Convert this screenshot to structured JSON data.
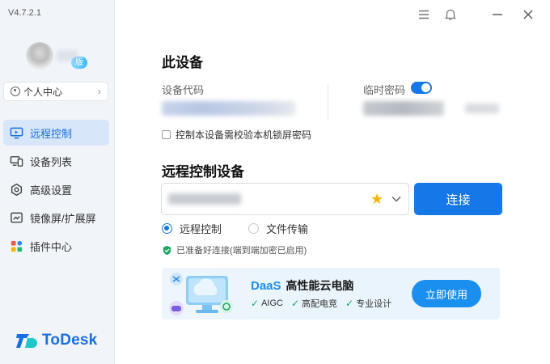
{
  "app": {
    "version": "V4.7.2.1",
    "brand": "ToDesk",
    "accent": "#1677e8"
  },
  "profile": {
    "badge": "版",
    "center_label": "个人中心"
  },
  "nav": {
    "items": [
      {
        "label": "远程控制",
        "icon": "remote-control-icon",
        "active": true
      },
      {
        "label": "设备列表",
        "icon": "device-list-icon",
        "active": false
      },
      {
        "label": "高级设置",
        "icon": "settings-icon",
        "active": false
      },
      {
        "label": "镜像屏/扩展屏",
        "icon": "mirror-screen-icon",
        "active": false
      },
      {
        "label": "插件中心",
        "icon": "plugin-icon",
        "active": false
      }
    ]
  },
  "titlebar": {
    "icons": [
      "menu-icon",
      "bell-icon",
      "minimize-icon",
      "close-icon"
    ]
  },
  "this_device": {
    "heading": "此设备",
    "code_label": "设备代码",
    "temp_password_label": "临时密码",
    "temp_password_enabled": true,
    "lock_checkbox_label": "控制本设备需校验本机锁屏密码",
    "lock_checkbox_checked": false
  },
  "remote": {
    "heading": "远程控制设备",
    "input_placeholder": "",
    "connect_label": "连接",
    "modes": [
      {
        "label": "远程控制",
        "selected": true
      },
      {
        "label": "文件传输",
        "selected": false
      }
    ],
    "status_text": "已准备好连接(端到端加密已启用)"
  },
  "banner": {
    "daas": "DaaS",
    "title": "高性能云电脑",
    "features": [
      "AIGC",
      "高配电竞",
      "专业设计"
    ],
    "button": "立即使用"
  }
}
